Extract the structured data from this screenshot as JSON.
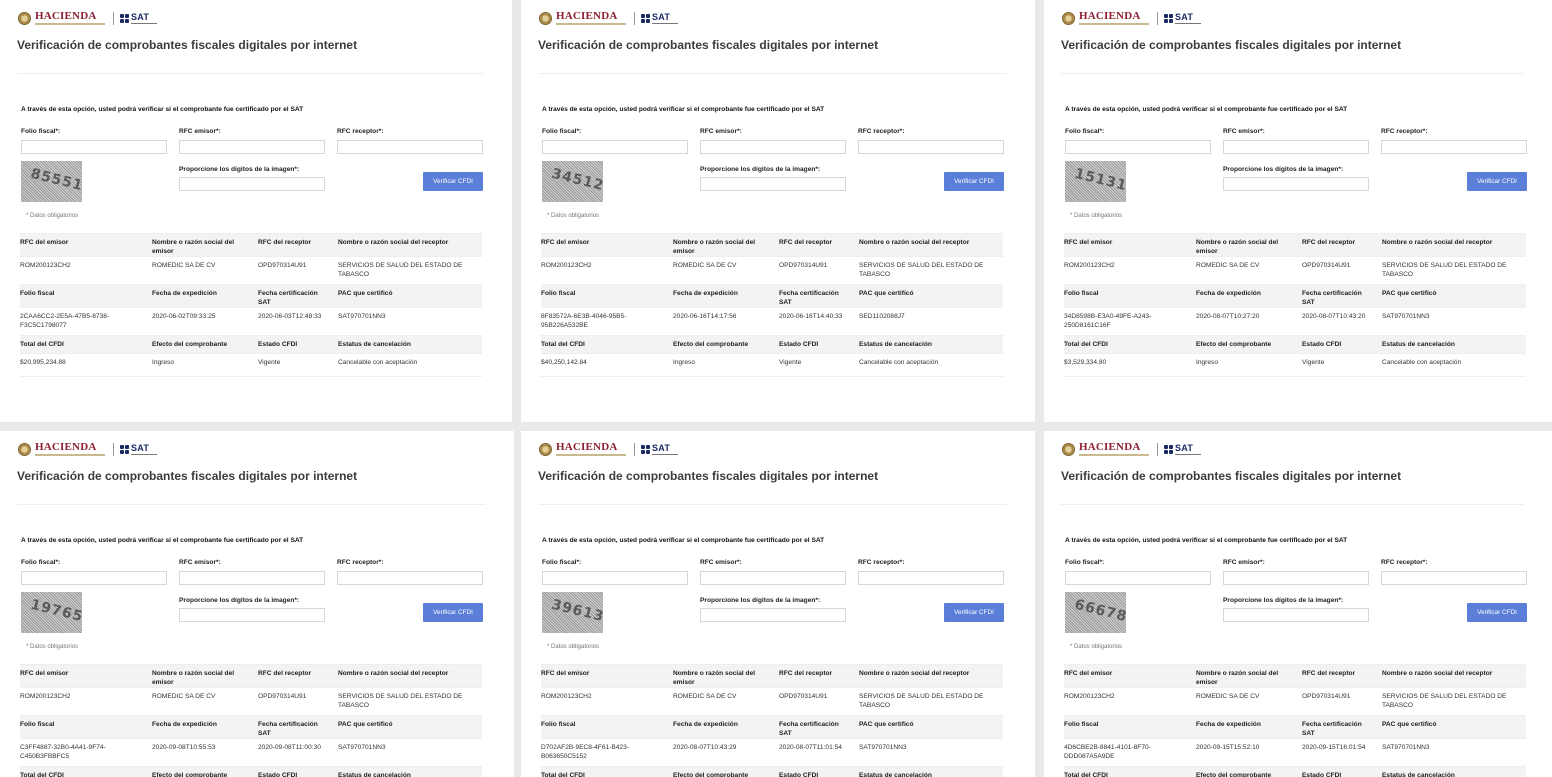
{
  "header": {
    "hacienda_logo_text": "HACIENDA",
    "sat_logo_text": "SAT",
    "title": "Verificación de comprobantes fiscales digitales por internet"
  },
  "form": {
    "intro": "A través de esta opción, usted podrá verificar si el comprobante fue certificado por el SAT",
    "labels": {
      "folio": "Folio fiscal*:",
      "rfc_emisor": "RFC emisor*:",
      "rfc_receptor": "RFC receptor*:",
      "digits": "Proporcione los dígitos de la imagen*:"
    },
    "verify_button": "Verificar CFDI",
    "required_note": "* Datos obligatorios"
  },
  "table_headers": {
    "rfc_emisor": "RFC del emisor",
    "nombre_emisor": "Nombre o razón social del emisor",
    "rfc_receptor": "RFC del receptor",
    "nombre_receptor": "Nombre o razón social del receptor",
    "folio": "Folio fiscal",
    "fecha_expedicion": "Fecha de expedición",
    "fecha_certificacion": "Fecha certificación SAT",
    "pac": "PAC que certificó",
    "total": "Total del CFDI",
    "efecto": "Efecto del comprobante",
    "estado": "Estado CFDI",
    "estatus_cancelacion": "Estatus de cancelación"
  },
  "panels": [
    {
      "captcha": "85551",
      "rfc_emisor": "ROM200123CH2",
      "nombre_emisor": "ROMEDIC SA DE CV",
      "rfc_receptor": "OPD970314U91",
      "nombre_receptor": "SERVICIOS DE SALUD DEL ESTADO DE TABASCO",
      "folio": "2CAA6CC2-2E5A-47B5-8738-F3C5C1798077",
      "fecha_expedicion": "2020-06-02T09:33:25",
      "fecha_certificacion": "2020-06-03T12:48:33",
      "pac": "SAT970701NN3",
      "total": "$20,995,234.88",
      "efecto": "Ingreso",
      "estado": "Vigente",
      "estatus_cancelacion": "Cancelable con aceptación"
    },
    {
      "captcha": "34512",
      "rfc_emisor": "ROM200123CH2",
      "nombre_emisor": "ROMEDIC SA DE CV",
      "rfc_receptor": "OPD970314U91",
      "nombre_receptor": "SERVICIOS DE SALUD DEL ESTADO DE TABASCO",
      "folio": "8F83572A-6E3B-4046-95B5-95B226A532BE",
      "fecha_expedicion": "2020-06-16T14:17:56",
      "fecha_certificacion": "2020-06-16T14:40:33",
      "pac": "SED1102088J7",
      "total": "$40,250,142.84",
      "efecto": "Ingreso",
      "estado": "Vigente",
      "estatus_cancelacion": "Cancelable con aceptación"
    },
    {
      "captcha": "15131",
      "rfc_emisor": "ROM200123CH2",
      "nombre_emisor": "ROMEDIC SA DE CV",
      "rfc_receptor": "OPD970314U91",
      "nombre_receptor": "SERVICIOS DE SALUD DEL ESTADO DE TABASCO",
      "folio": "34D8598B-E3A0-49FE-A243-250D8161C16F",
      "fecha_expedicion": "2020-08-07T10:27:20",
      "fecha_certificacion": "2020-08-07T10:43:20",
      "pac": "SAT970701NN3",
      "total": "$3,529,334.80",
      "efecto": "Ingreso",
      "estado": "Vigente",
      "estatus_cancelacion": "Cancelable con aceptación"
    },
    {
      "captcha": "19765",
      "rfc_emisor": "ROM200123CH2",
      "nombre_emisor": "ROMEDIC SA DE CV",
      "rfc_receptor": "OPD970314U91",
      "nombre_receptor": "SERVICIOS DE SALUD DEL ESTADO DE TABASCO",
      "folio": "C3FF4887-32B0-4A41-9F74-C450B3FBBFC5",
      "fecha_expedicion": "2020-09-08T10:55:53",
      "fecha_certificacion": "2020-09-08T11:00:30",
      "pac": "SAT970701NN3"
    },
    {
      "captcha": "39613",
      "rfc_emisor": "ROM200123CH2",
      "nombre_emisor": "ROMEDIC SA DE CV",
      "rfc_receptor": "OPD970314U91",
      "nombre_receptor": "SERVICIOS DE SALUD DEL ESTADO DE TABASCO",
      "folio": "D702AF2B-9EC8-4F61-B423-B063650C5152",
      "fecha_expedicion": "2020-08-07T10:43:29",
      "fecha_certificacion": "2020-08-07T11:01:54",
      "pac": "SAT970701NN3"
    },
    {
      "captcha": "66678",
      "rfc_emisor": "ROM200123CH2",
      "nombre_emisor": "ROMEDIC SA DE CV",
      "rfc_receptor": "OPD970314U91",
      "nombre_receptor": "SERVICIOS DE SALUD DEL ESTADO DE TABASCO",
      "folio": "4D6CBE2B-8841-4101-8F70-DDD087A5A9DE",
      "fecha_expedicion": "2020-09-15T15:52:10",
      "fecha_certificacion": "2020-09-15T16:01:54",
      "pac": "SAT970701NN3"
    }
  ]
}
